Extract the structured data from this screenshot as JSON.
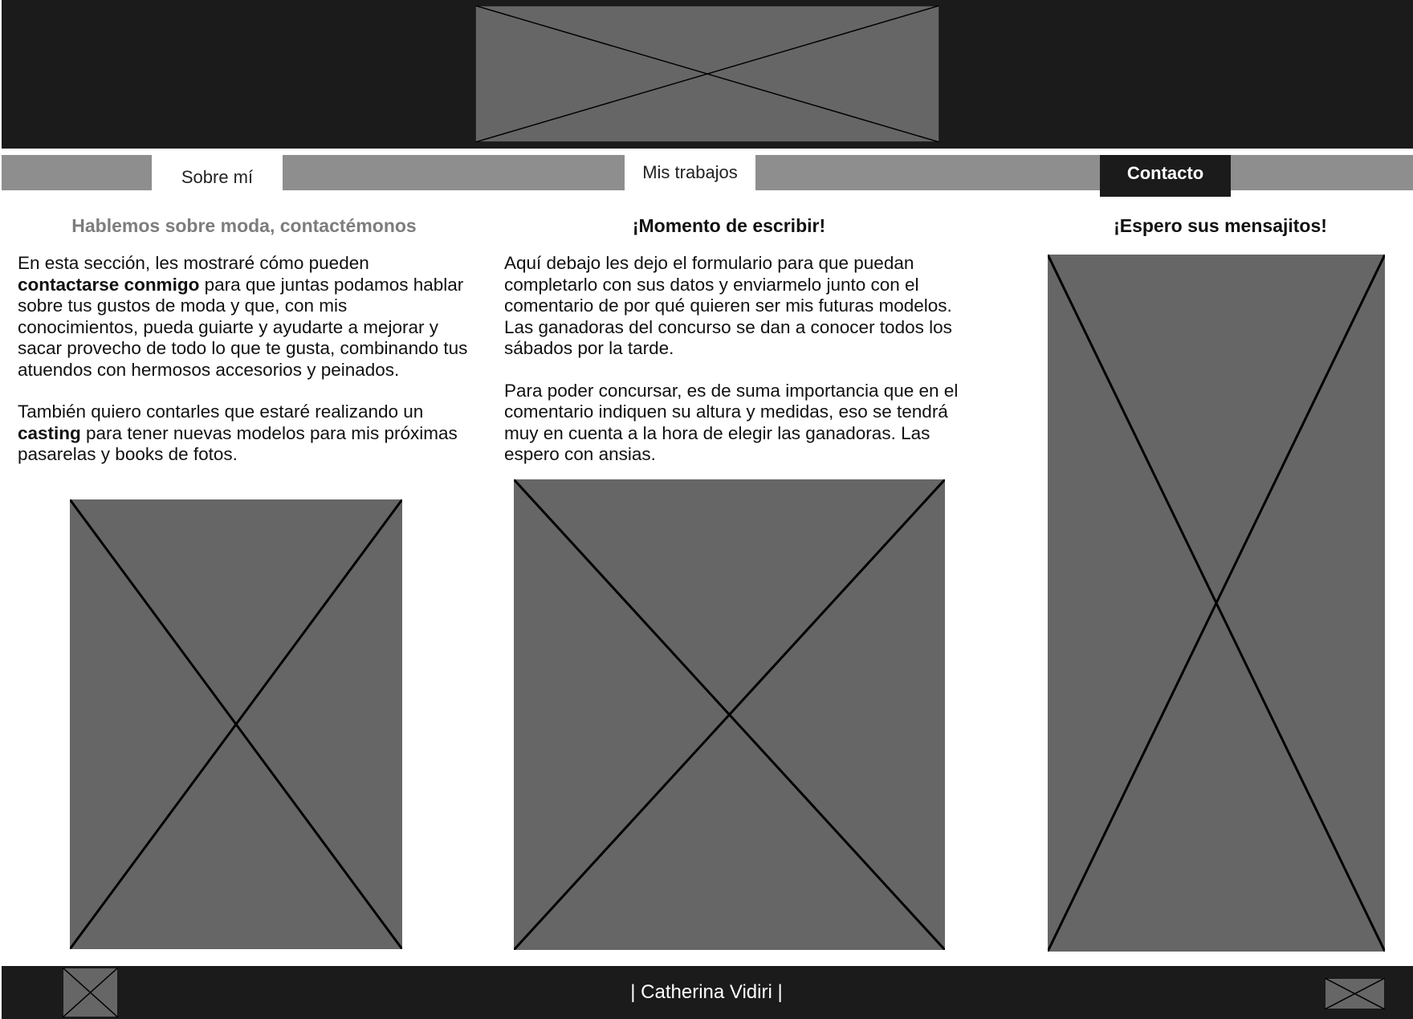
{
  "nav": {
    "items": [
      {
        "label": "Sobre mí"
      },
      {
        "label": "Mis trabajos"
      },
      {
        "label": "Contacto",
        "active": true
      }
    ]
  },
  "columns": [
    {
      "title": "Hablemos sobre moda, contactémonos",
      "paragraphs": [
        {
          "t1": "En esta sección, les mostraré cómo pueden ",
          "b1": "contactarse conmigo",
          "t2": " para que juntas podamos hablar sobre tus gustos de moda y que, con mis conocimientos, pueda guiarte y ayudarte a mejorar y sacar provecho de todo lo que te gusta, combinando tus atuendos con hermosos accesorios y peinados."
        },
        {
          "t1": "También quiero contarles que estaré realizando un ",
          "b1": "casting",
          "t2": " para tener nuevas modelos para mis próximas pasarelas y books de fotos."
        }
      ]
    },
    {
      "title": "¡Momento de escribir!",
      "paragraphs": [
        "Aquí debajo les dejo el formulario para que puedan completarlo con sus datos y enviarmelo junto con el comentario de por qué quieren ser mis futuras modelos. Las ganadoras del concurso se dan a conocer todos los sábados por la tarde.",
        "Para poder concursar, es de suma importancia que en el comentario indiquen su altura y medidas, eso se tendrá muy en cuenta a la hora de elegir las ganadoras. Las espero con ansias."
      ]
    },
    {
      "title": "¡Espero sus mensajitos!"
    }
  ],
  "footer": {
    "name": "| Catherina Vidiri |"
  },
  "colors": {
    "dark": "#1b1b1b",
    "nav_bar": "#8e8e8e",
    "placeholder": "#666666",
    "muted_title": "#7d7d7d"
  }
}
